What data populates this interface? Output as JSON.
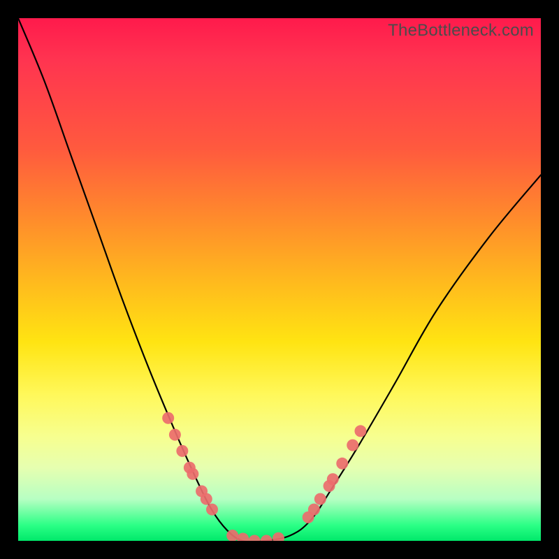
{
  "watermark": {
    "text": "TheBottleneck.com"
  },
  "chart_data": {
    "type": "line",
    "title": "",
    "xlabel": "",
    "ylabel": "",
    "series": [
      {
        "name": "bottleneck-curve",
        "x": [
          0.0,
          0.05,
          0.1,
          0.15,
          0.2,
          0.25,
          0.3,
          0.34,
          0.37,
          0.4,
          0.43,
          0.47,
          0.52,
          0.56,
          0.6,
          0.65,
          0.72,
          0.8,
          0.9,
          1.0
        ],
        "y": [
          1.0,
          0.88,
          0.74,
          0.6,
          0.46,
          0.33,
          0.21,
          0.12,
          0.06,
          0.02,
          0.0,
          0.0,
          0.01,
          0.04,
          0.1,
          0.18,
          0.3,
          0.44,
          0.58,
          0.7
        ]
      }
    ],
    "markers": {
      "left_cluster": {
        "x": [
          0.287,
          0.3,
          0.314,
          0.328,
          0.334,
          0.351,
          0.36,
          0.371
        ],
        "y": [
          0.235,
          0.203,
          0.172,
          0.14,
          0.128,
          0.095,
          0.08,
          0.06
        ]
      },
      "flat_cluster": {
        "x": [
          0.41,
          0.43,
          0.452,
          0.475,
          0.498
        ],
        "y": [
          0.01,
          0.004,
          0.0,
          0.0,
          0.005
        ]
      },
      "right_cluster": {
        "x": [
          0.555,
          0.566,
          0.578,
          0.595,
          0.602,
          0.62,
          0.64,
          0.655
        ],
        "y": [
          0.045,
          0.06,
          0.08,
          0.105,
          0.118,
          0.148,
          0.183,
          0.21
        ]
      }
    },
    "xlim": [
      0,
      1
    ],
    "ylim": [
      0,
      1
    ],
    "background_gradient": {
      "top_color": "#ff1a4c",
      "bottom_color": "#00e86a"
    }
  }
}
